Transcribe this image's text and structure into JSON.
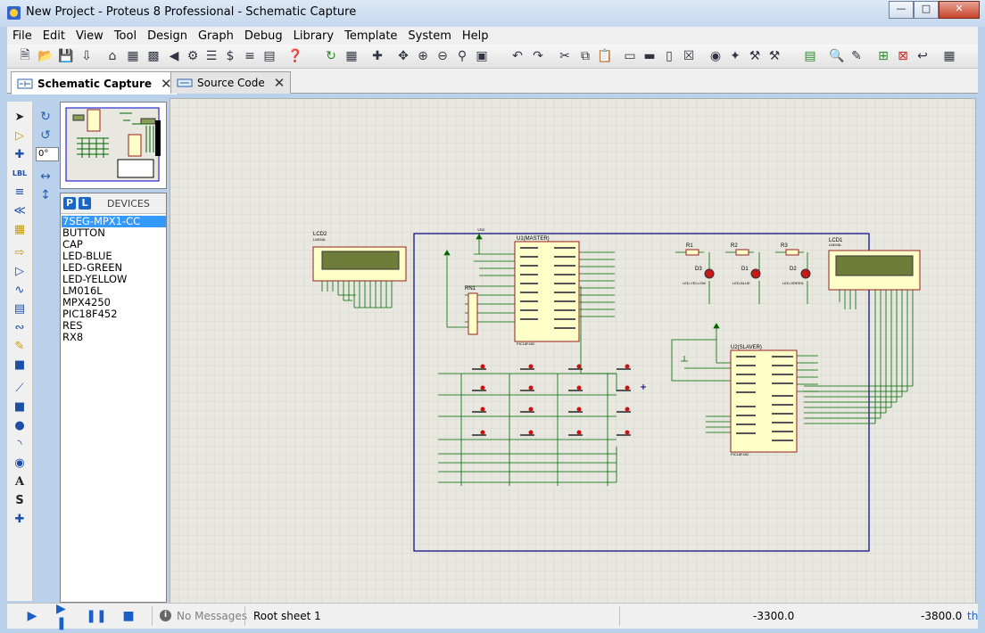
{
  "window": {
    "title": "New Project - Proteus 8 Professional - Schematic Capture"
  },
  "menu": [
    "File",
    "Edit",
    "View",
    "Tool",
    "Design",
    "Graph",
    "Debug",
    "Library",
    "Template",
    "System",
    "Help"
  ],
  "tabs": [
    {
      "label": "Schematic Capture",
      "active": true
    },
    {
      "label": "Source Code",
      "active": false
    }
  ],
  "rotation": {
    "angle": "0°"
  },
  "devices": {
    "modes": [
      "P",
      "L"
    ],
    "title": "DEVICES",
    "items": [
      "7SEG-MPX1-CC",
      "BUTTON",
      "CAP",
      "LED-BLUE",
      "LED-GREEN",
      "LED-YELLOW",
      "LM016L",
      "MPX4250",
      "PIC18F452",
      "RES",
      "RX8"
    ],
    "selected": "7SEG-MPX1-CC"
  },
  "schematic": {
    "components": {
      "lcd2": "LCD2",
      "lcd2_type": "LM016L",
      "lcd1": "LCD1",
      "lcd1_type": "LM016L",
      "u1": "U1(MASTER)",
      "u1_type": "PIC18F452",
      "u2": "U2(SLAVER)",
      "u2_type": "PIC18F452",
      "rn1": "RN1",
      "r1": "R1",
      "r2": "R2",
      "r3": "R3",
      "d1": "D1",
      "d2": "D2",
      "d3": "D3",
      "d1_type": "LED-BLUE",
      "d2_type": "LED-GREEN",
      "d3_type": "LED-YELLOW",
      "vdd": "VDD"
    }
  },
  "status": {
    "messages": "No Messages",
    "sheet": "Root sheet 1",
    "coord_x": "-3300.0",
    "coord_y": "-3800.0",
    "unit": "th"
  },
  "colors": {
    "wire": "#006400",
    "component_body": "#ffffc8",
    "component_border": "#9a1e1e",
    "sheet_border": "#000080",
    "grid_bg": "#e8e8e0"
  }
}
